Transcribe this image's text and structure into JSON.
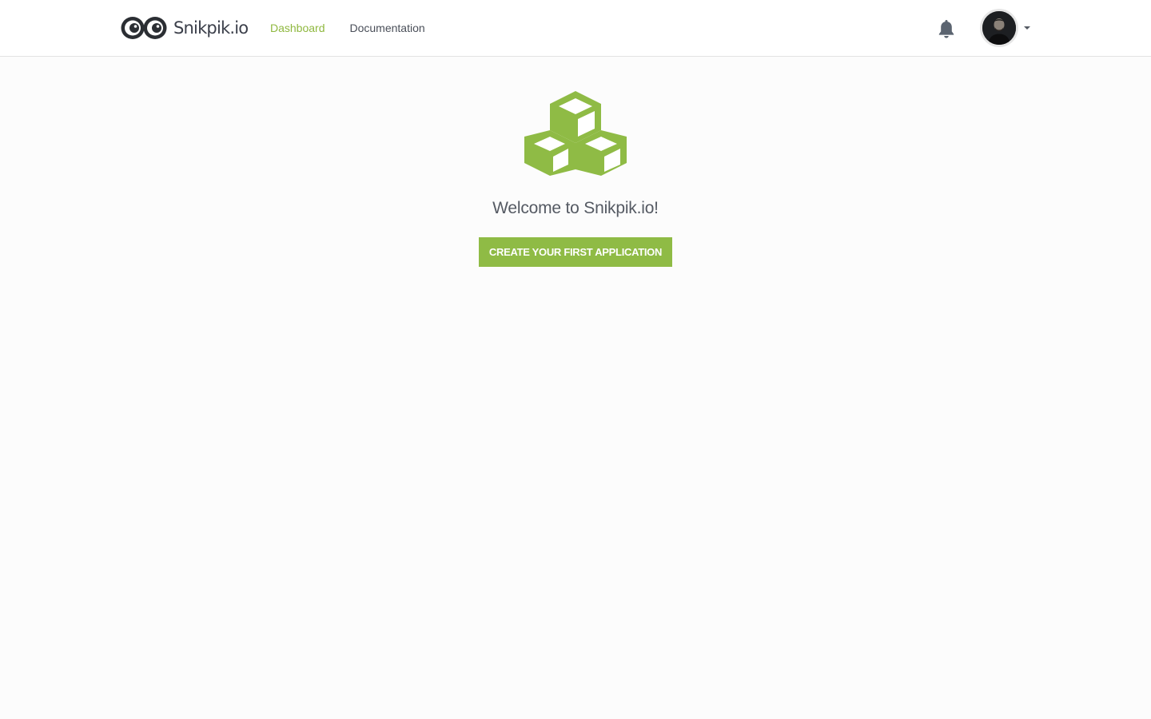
{
  "brand": {
    "name": "Snikpik.io",
    "logo_icon": "eyes-logo-icon"
  },
  "nav": {
    "items": [
      {
        "label": "Dashboard",
        "active": true
      },
      {
        "label": "Documentation",
        "active": false
      }
    ]
  },
  "header": {
    "notifications_icon": "bell-icon",
    "account_menu_icon": "chevron-down-icon",
    "avatar_icon": "user-avatar"
  },
  "empty_state": {
    "illustration_icon": "cubes-icon",
    "welcome_text": "Welcome to Snikpik.io!",
    "cta_label": "CREATE YOUR FIRST APPLICATION"
  },
  "colors": {
    "accent": "#8fbb45",
    "nav_active": "#8fb83f",
    "text_dark": "#4a4f59",
    "background": "#fcfcfc",
    "header_background": "#ffffff"
  }
}
